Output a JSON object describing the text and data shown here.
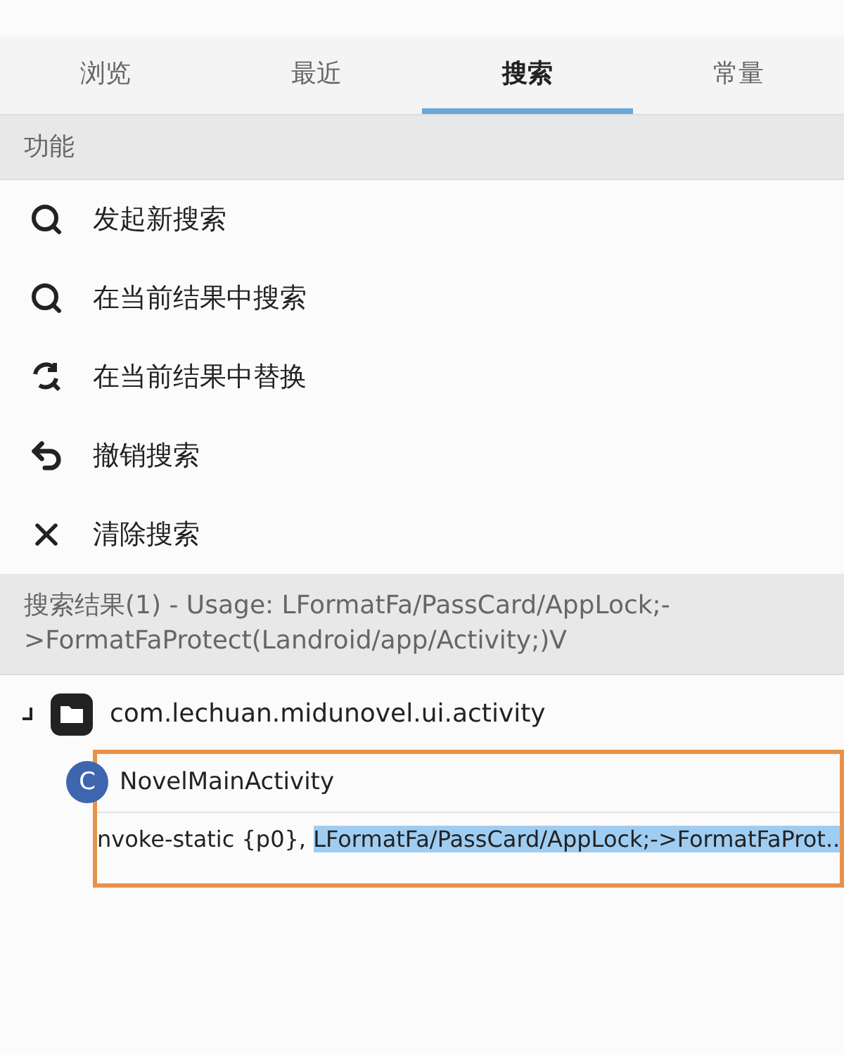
{
  "tabs": [
    {
      "label": "浏览",
      "selected": false
    },
    {
      "label": "最近",
      "selected": false
    },
    {
      "label": "搜索",
      "selected": true
    },
    {
      "label": "常量",
      "selected": false
    }
  ],
  "functions": {
    "title": "功能",
    "items": [
      {
        "kind": "search",
        "label": "发起新搜索"
      },
      {
        "kind": "search",
        "label": "在当前结果中搜索"
      },
      {
        "kind": "replace",
        "label": "在当前结果中替换"
      },
      {
        "kind": "undo",
        "label": "撤销搜索"
      },
      {
        "kind": "clear",
        "label": "清除搜索"
      }
    ]
  },
  "results": {
    "title": "搜索结果(1) - Usage: LFormatFa/PassCard/AppLock;->FormatFaProtect(Landroid/app/Activity;)V",
    "tree": [
      {
        "label": "com.lechuan.midunovel.ui.activity",
        "expanded": true,
        "children": [
          {
            "badge": "C",
            "label": "NovelMainActivity",
            "children": [
              {
                "text": "nvoke-static {p0}, ",
                "selection": "LFormatFa/PassCard/AppLock;->FormatFaProt.."
              }
            ]
          }
        ]
      }
    ]
  }
}
